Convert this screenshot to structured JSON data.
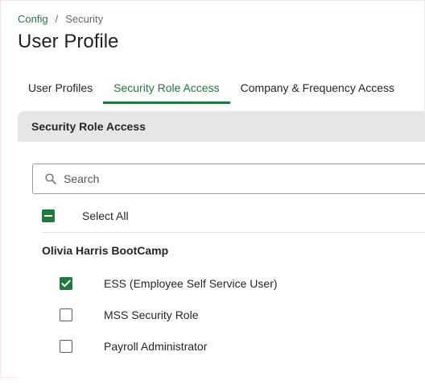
{
  "breadcrumb": {
    "link": "Config",
    "separator": "/",
    "current": "Security"
  },
  "page": {
    "title": "User Profile"
  },
  "tabs": [
    {
      "label": "User Profiles",
      "active": false
    },
    {
      "label": "Security Role Access",
      "active": true
    },
    {
      "label": "Company & Frequency Access",
      "active": false
    }
  ],
  "panel": {
    "header": "Security Role Access",
    "search": {
      "placeholder": "Search",
      "value": "",
      "icon": "search-icon"
    },
    "select_all": {
      "label": "Select All",
      "state": "indeterminate"
    },
    "group": {
      "title": "Olivia Harris BootCamp",
      "roles": [
        {
          "label": "ESS (Employee Self Service User)",
          "checked": true
        },
        {
          "label": "MSS Security Role",
          "checked": false
        },
        {
          "label": "Payroll Administrator",
          "checked": false
        }
      ]
    }
  },
  "colors": {
    "accent": "#1f7a3f",
    "panel_header_bg": "#e6e6e6",
    "text": "#262626"
  }
}
